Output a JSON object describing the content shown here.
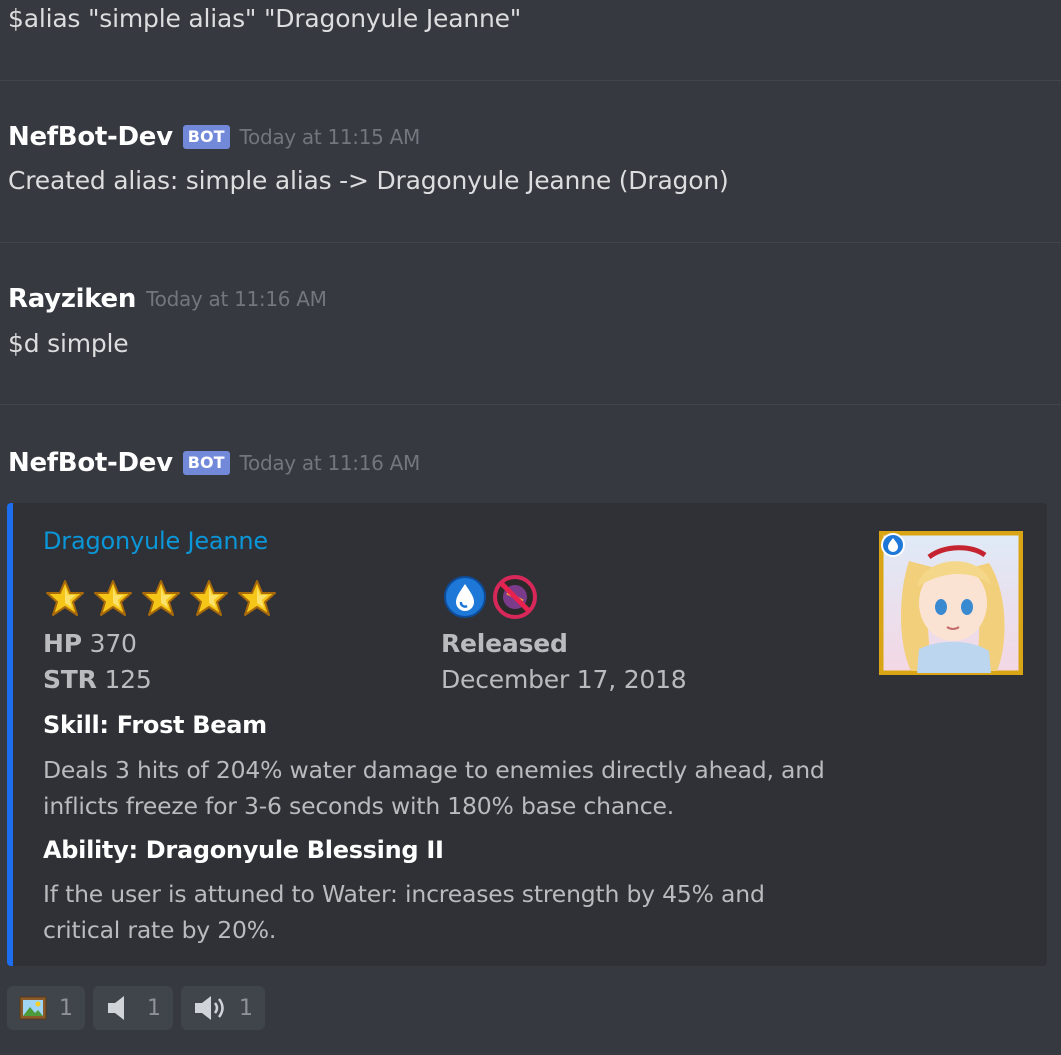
{
  "messages": {
    "command1": "$alias \"simple alias\" \"Dragonyule Jeanne\"",
    "reply1": {
      "username": "NefBot-Dev",
      "bot_tag": "BOT",
      "timestamp": "Today at 11:15 AM",
      "text": "Created alias: simple alias -> Dragonyule Jeanne (Dragon)"
    },
    "user_msg": {
      "username": "Rayziken",
      "timestamp": "Today at 11:16 AM",
      "text": "$d simple"
    },
    "reply2": {
      "username": "NefBot-Dev",
      "bot_tag": "BOT",
      "timestamp": "Today at 11:16 AM"
    }
  },
  "embed": {
    "accent_color": "#1d6df0",
    "title": "Dragonyule Jeanne",
    "rarity_stars": 5,
    "element_icon": "water-element-icon",
    "restriction_icon": "no-weapon-icon",
    "hp_label": "HP",
    "hp_value": "370",
    "str_label": "STR",
    "str_value": "125",
    "released_label": "Released",
    "released_value": "December 17, 2018",
    "skill_title": "Skill: Frost Beam",
    "skill_desc_line1": "Deals 3 hits of 204% water damage to enemies directly ahead, and",
    "skill_desc_line2": "inflicts freeze for 3-6 seconds with 180% base chance.",
    "ability_title": "Ability: Dragonyule Blessing II",
    "ability_desc_line1": "If the user is attuned to Water: increases strength by 45% and",
    "ability_desc_line2": "critical rate by 20%.",
    "thumbnail": "dragonyule-jeanne-portrait"
  },
  "reactions": [
    {
      "icon": "framed-picture-emoji",
      "count": "1"
    },
    {
      "icon": "speaker-low-emoji",
      "count": "1"
    },
    {
      "icon": "speaker-sound-emoji",
      "count": "1"
    }
  ]
}
